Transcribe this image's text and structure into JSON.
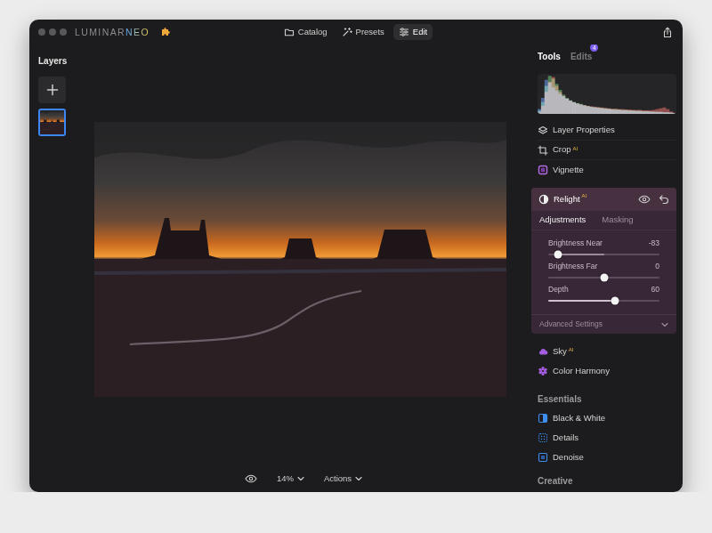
{
  "window": {
    "logo": {
      "main": "LUMINAR",
      "accent": "NEO"
    }
  },
  "nav": [
    {
      "label": "Catalog",
      "selected": false
    },
    {
      "label": "Presets",
      "selected": false
    },
    {
      "label": "Edit",
      "selected": true
    }
  ],
  "layers": {
    "title": "Layers",
    "items": [
      {
        "selected": true
      }
    ]
  },
  "canvas": {
    "zoom": "14%",
    "actions": "Actions"
  },
  "panel": {
    "tabs": [
      {
        "label": "Tools",
        "selected": true
      },
      {
        "label": "Edits",
        "selected": false,
        "badge": "4"
      }
    ]
  },
  "histogram": {
    "series": [
      {
        "color": "#d9524a",
        "values": [
          5,
          20,
          55,
          80,
          92,
          70,
          55,
          45,
          38,
          33,
          29,
          26,
          24,
          22,
          20,
          19,
          18,
          17,
          16,
          15,
          14,
          13,
          13,
          12,
          12,
          11,
          11,
          10,
          10,
          10,
          9,
          9,
          9,
          10,
          12,
          14,
          16,
          12,
          6,
          3
        ]
      },
      {
        "color": "#4fb35a",
        "values": [
          8,
          30,
          70,
          95,
          88,
          75,
          60,
          48,
          40,
          34,
          30,
          27,
          25,
          22,
          20,
          18,
          17,
          16,
          15,
          14,
          13,
          12,
          12,
          11,
          10,
          10,
          9,
          9,
          8,
          8,
          7,
          7,
          6,
          6,
          5,
          5,
          4,
          4,
          3,
          2
        ]
      },
      {
        "color": "#4d7fe0",
        "values": [
          12,
          40,
          85,
          78,
          66,
          58,
          50,
          44,
          38,
          33,
          29,
          26,
          23,
          21,
          19,
          17,
          16,
          15,
          14,
          13,
          12,
          11,
          10,
          10,
          9,
          9,
          8,
          8,
          7,
          7,
          6,
          6,
          6,
          5,
          5,
          5,
          4,
          4,
          3,
          2
        ]
      }
    ]
  },
  "tools": [
    {
      "label": "Layer Properties"
    },
    {
      "label": "Crop",
      "badge": "AI"
    },
    {
      "label": "Vignette"
    }
  ],
  "relight": {
    "title": "Relight",
    "badge": "AI",
    "expanded": true,
    "tabs": [
      {
        "label": "Adjustments",
        "selected": true
      },
      {
        "label": "Masking",
        "selected": false
      }
    ],
    "sliders": [
      {
        "label": "Brightness Near",
        "reading": "-83",
        "level": 0.09,
        "kind": "bipolar"
      },
      {
        "label": "Brightness Far",
        "reading": "0",
        "level": 0.5,
        "kind": "bipolar"
      },
      {
        "label": "Depth",
        "reading": "60",
        "level": 0.6,
        "kind": "unipolar"
      }
    ],
    "advanced": {
      "label": "Advanced Settings",
      "expanded": false
    }
  },
  "tools_more": [
    {
      "label": "Sky",
      "badge": "AI"
    },
    {
      "label": "Color Harmony"
    }
  ],
  "sections": [
    {
      "title": "Essentials",
      "items": [
        {
          "label": "Black & White"
        },
        {
          "label": "Details"
        },
        {
          "label": "Denoise"
        }
      ]
    },
    {
      "title": "Creative",
      "items": []
    }
  ]
}
